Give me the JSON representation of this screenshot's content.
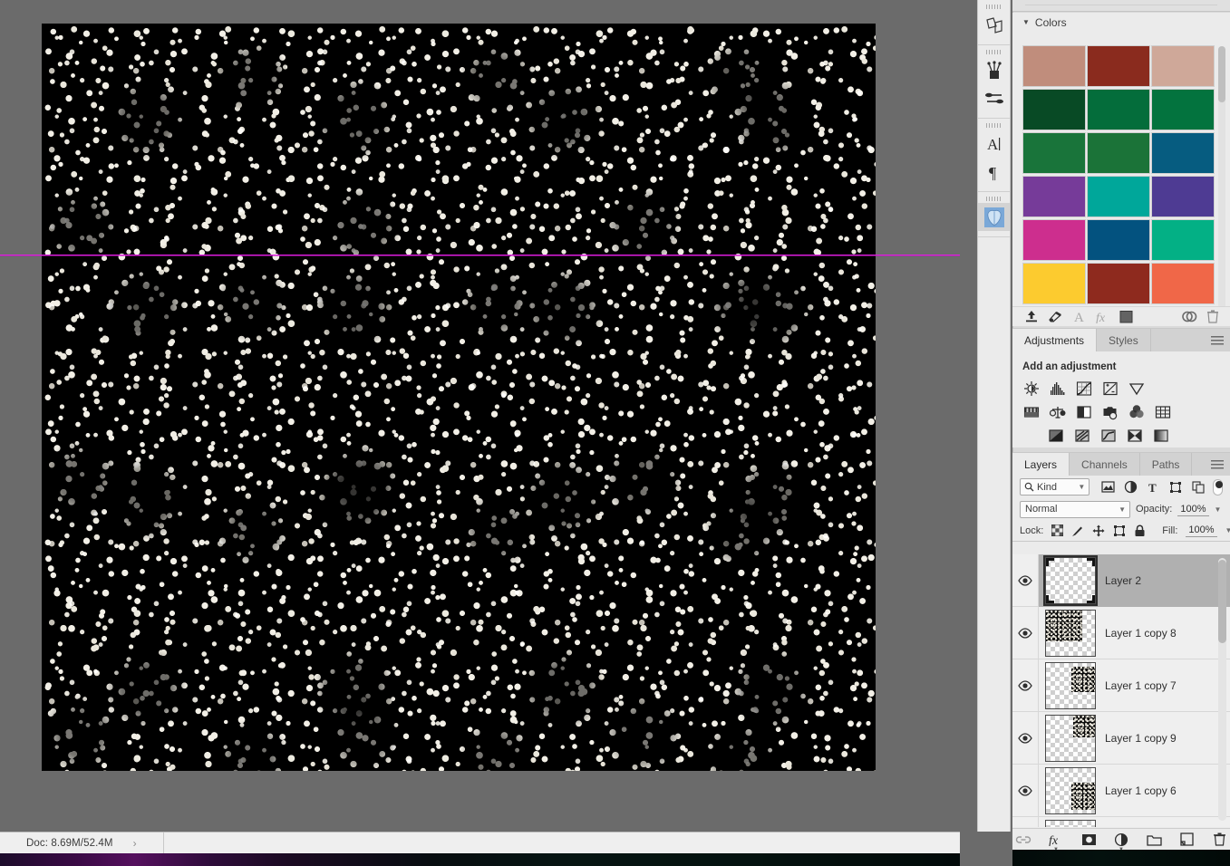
{
  "document": {
    "status_text": "Doc: 8.69M/52.4M",
    "status_expand_glyph": "›",
    "canvas_description": "black canvas with dense white baby's-breath floral pattern",
    "guide_color": "#e01ee0"
  },
  "tool_strip": {
    "groups": [
      {
        "tools": [
          {
            "name": "shape-tool",
            "label": "Shape Tool"
          }
        ]
      },
      {
        "tools": [
          {
            "name": "brush-tool",
            "label": "Brush Tool"
          },
          {
            "name": "gradient-tool",
            "label": "Gradient Tool"
          }
        ]
      },
      {
        "tools": [
          {
            "name": "type-tool",
            "label": "Type Tool"
          },
          {
            "name": "paragraph-tool",
            "label": "Paragraph Tool"
          }
        ]
      },
      {
        "tools": [
          {
            "name": "custom-shape-tool",
            "label": "Custom Shape Tool"
          }
        ]
      }
    ]
  },
  "colors_panel": {
    "title": "Colors",
    "collapse_glyph": "▼",
    "swatches": [
      "#c08d7c",
      "#8a2b1e",
      "#cfa899",
      "#084a25",
      "#046d3b",
      "#03733e",
      "#19743a",
      "#1b7338",
      "#065c80",
      "#763b99",
      "#00a79a",
      "#4e3b93",
      "#cd2e8e",
      "#03527f",
      "#03b085",
      "#fccb2f",
      "#8e2a1e",
      "#f06748",
      "#8e2a1e",
      "#f2a949",
      "#f2a949"
    ],
    "footer_icons": [
      {
        "name": "load-swatches-icon",
        "label": "Load Swatches"
      },
      {
        "name": "color-picker-icon",
        "label": "Color Picker"
      },
      {
        "name": "text-color-icon",
        "label": "Text Color"
      },
      {
        "name": "effects-fx-icon",
        "label": "Effects"
      },
      {
        "name": "foreground-color-icon",
        "label": "Foreground Color"
      },
      {
        "name": "creative-cloud-icon",
        "label": "Creative Cloud Libraries"
      },
      {
        "name": "delete-swatch-icon",
        "label": "Delete Swatch"
      }
    ]
  },
  "adjustments_panel": {
    "tabs": [
      {
        "label": "Adjustments",
        "active": true
      },
      {
        "label": "Styles",
        "active": false
      }
    ],
    "heading": "Add an adjustment",
    "rows": [
      [
        {
          "name": "brightness-contrast-icon",
          "label": "Brightness/Contrast"
        },
        {
          "name": "levels-icon",
          "label": "Levels"
        },
        {
          "name": "curves-icon",
          "label": "Curves"
        },
        {
          "name": "exposure-icon",
          "label": "Exposure"
        },
        {
          "name": "vibrance-icon",
          "label": "Vibrance"
        }
      ],
      [
        {
          "name": "hue-saturation-icon",
          "label": "Hue/Saturation"
        },
        {
          "name": "color-balance-icon",
          "label": "Color Balance"
        },
        {
          "name": "black-white-icon",
          "label": "Black & White"
        },
        {
          "name": "photo-filter-icon",
          "label": "Photo Filter"
        },
        {
          "name": "channel-mixer-icon",
          "label": "Channel Mixer"
        },
        {
          "name": "color-lookup-icon",
          "label": "Color Lookup"
        }
      ],
      [
        {
          "name": "invert-icon",
          "label": "Invert"
        },
        {
          "name": "posterize-icon",
          "label": "Posterize"
        },
        {
          "name": "threshold-icon",
          "label": "Threshold"
        },
        {
          "name": "selective-color-icon",
          "label": "Selective Color"
        },
        {
          "name": "gradient-map-icon",
          "label": "Gradient Map"
        }
      ]
    ]
  },
  "layers_panel": {
    "tabs": [
      {
        "label": "Layers",
        "active": true
      },
      {
        "label": "Channels",
        "active": false
      },
      {
        "label": "Paths",
        "active": false
      }
    ],
    "filter": {
      "kind_label": "Kind",
      "search_glyph": "⌕",
      "chevron": "▼",
      "icons": [
        {
          "name": "filter-pixel-layers-icon",
          "label": "Pixel Layers"
        },
        {
          "name": "filter-adjustment-layers-icon",
          "label": "Adjustment Layers"
        },
        {
          "name": "filter-type-layers-icon",
          "label": "Type Layers"
        },
        {
          "name": "filter-shape-layers-icon",
          "label": "Shape Layers"
        },
        {
          "name": "filter-smart-objects-icon",
          "label": "Smart Objects"
        }
      ],
      "toggle_name": "filter-enable-toggle"
    },
    "blend": {
      "mode": "Normal",
      "opacity_label": "Opacity:",
      "opacity_value": "100%",
      "chevron": "▼"
    },
    "lock": {
      "label": "Lock:",
      "fill_label": "Fill:",
      "fill_value": "100%",
      "chevron": "▼",
      "icons": [
        {
          "name": "lock-transparent-pixels-icon",
          "label": "Lock transparent pixels"
        },
        {
          "name": "lock-image-pixels-icon",
          "label": "Lock image pixels"
        },
        {
          "name": "lock-position-icon",
          "label": "Lock position"
        },
        {
          "name": "lock-artboard-nesting-icon",
          "label": "Prevent auto-nesting"
        },
        {
          "name": "lock-all-icon",
          "label": "Lock all"
        }
      ]
    },
    "layers": [
      {
        "name": "Layer 2",
        "selected": true,
        "visible": true,
        "thumb": "full"
      },
      {
        "name": "Layer 1 copy 8",
        "selected": false,
        "visible": true,
        "thumb": "tl"
      },
      {
        "name": "Layer 1 copy 7",
        "selected": false,
        "visible": true,
        "thumb": "tc"
      },
      {
        "name": "Layer 1 copy 9",
        "selected": false,
        "visible": true,
        "thumb": "tr"
      },
      {
        "name": "Layer 1 copy 6",
        "selected": false,
        "visible": true,
        "thumb": "cr"
      },
      {
        "name": "",
        "selected": false,
        "visible": true,
        "thumb": "partial"
      }
    ],
    "footer_icons": [
      {
        "name": "link-layers-icon",
        "label": "Link layers"
      },
      {
        "name": "layer-style-fx-icon",
        "label": "Add a layer style"
      },
      {
        "name": "add-layer-mask-icon",
        "label": "Add layer mask"
      },
      {
        "name": "new-fill-adjustment-icon",
        "label": "Create new fill or adjustment layer"
      },
      {
        "name": "new-group-icon",
        "label": "Create a new group"
      },
      {
        "name": "new-layer-icon",
        "label": "Create a new layer"
      },
      {
        "name": "delete-layer-icon",
        "label": "Delete layer"
      }
    ]
  }
}
